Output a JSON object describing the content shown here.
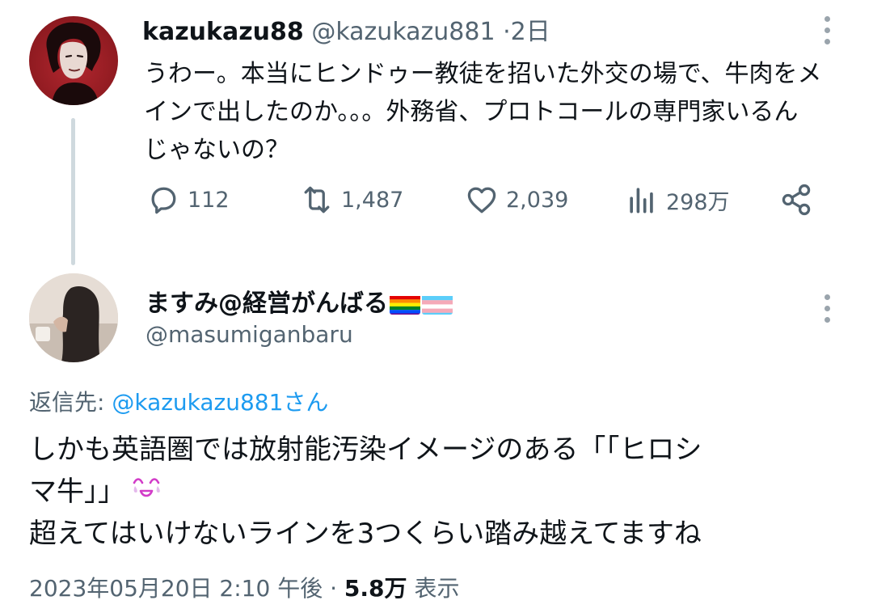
{
  "parent_tweet": {
    "display_name": "kazukazu88",
    "handle": "@kazukazu881",
    "separator": "·",
    "time": "2日",
    "text_lines": [
      "うわー。本当にヒンドゥー教徒を招いた外交の場で、牛肉をメ",
      "インで出したのか。。。外務省、プロトコールの専門家いるん",
      "じゃないの？"
    ],
    "stats": {
      "replies": "112",
      "retweets": "1,487",
      "likes": "2,039",
      "views": "298万"
    }
  },
  "reply_tweet": {
    "display_name": "ますみ@経営がんばる",
    "handle": "@masumiganbaru",
    "reply_to_label": "返信先:",
    "reply_to_user": "@kazukazu881さん",
    "text_lines": [
      "しかも英語圏では放射能汚染イメージのある「「ヒロシ",
      "マ牛」」",
      "超えてはいけないラインを3つくらい踏み越えてますね"
    ],
    "emoji_name": "crying-smiling-face",
    "timestamp": "2023年05月20日 2:10 午後",
    "meta_separator": "·",
    "view_count": "5.8万",
    "view_label": "表示"
  },
  "colors": {
    "text_primary": "#0f1419",
    "text_secondary": "#536471",
    "link": "#1d9bf0",
    "thread_line": "#cfd9de"
  },
  "icons": {
    "reply": "reply-icon",
    "retweet": "retweet-icon",
    "like": "heart-icon",
    "views": "views-icon",
    "share": "share-icon",
    "more": "more-vertical-icon",
    "pride_flag": "rainbow-flag-icon",
    "trans_flag": "transgender-flag-icon"
  }
}
